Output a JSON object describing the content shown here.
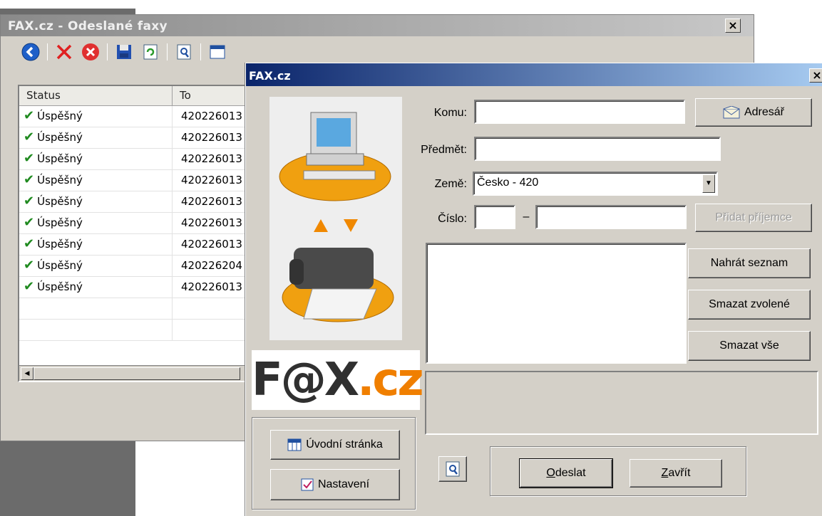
{
  "back_window": {
    "title": "FAX.cz - Odeslané faxy",
    "close_label": "×",
    "toolbar_icons": [
      "back-icon",
      "delete-icon",
      "cancel-icon",
      "save-icon",
      "refresh-icon",
      "preview-icon",
      "grid-icon"
    ],
    "list": {
      "columns": [
        "Status",
        "To"
      ],
      "rows": [
        {
          "status": "Úspěšný",
          "to": "420226013"
        },
        {
          "status": "Úspěšný",
          "to": "420226013"
        },
        {
          "status": "Úspěšný",
          "to": "420226013"
        },
        {
          "status": "Úspěšný",
          "to": "420226013"
        },
        {
          "status": "Úspěšný",
          "to": "420226013"
        },
        {
          "status": "Úspěšný",
          "to": "420226013"
        },
        {
          "status": "Úspěšný",
          "to": "420226013"
        },
        {
          "status": "Úspěšný",
          "to": "420226204"
        },
        {
          "status": "Úspěšný",
          "to": "420226013"
        }
      ]
    }
  },
  "dialog": {
    "title": "FAX.cz",
    "close_label": "×",
    "logo": {
      "part1": "F@X",
      "part2": ".cz"
    },
    "fields": {
      "komu": {
        "label": "Komu:",
        "value": ""
      },
      "predmet": {
        "label": "Předmět:",
        "value": ""
      },
      "zeme": {
        "label": "Země:",
        "value": "Česko - 420"
      },
      "cislo": {
        "label": "Číslo:",
        "prefix": "",
        "dash": "–",
        "number": ""
      }
    },
    "buttons": {
      "adresar": "Adresář",
      "pridat": "Přidat příjemce",
      "nahrat": "Nahrát seznam",
      "smazat_zvolene": "Smazat zvolené",
      "smazat_vse": "Smazat vše",
      "uvodni": "Úvodní stránka",
      "nastaveni": "Nastavení",
      "odeslat_u": "O",
      "odeslat_rest": "deslat",
      "zavrit_u": "Z",
      "zavrit_rest": "avřít"
    }
  },
  "colors": {
    "titlebar_active": "#0a246a",
    "titlebar_inactive": "#8a8a8a",
    "face": "#d4d0c8",
    "logo_dark": "#303030",
    "logo_orange": "#f07f00",
    "check_green": "#1f8a1f"
  }
}
